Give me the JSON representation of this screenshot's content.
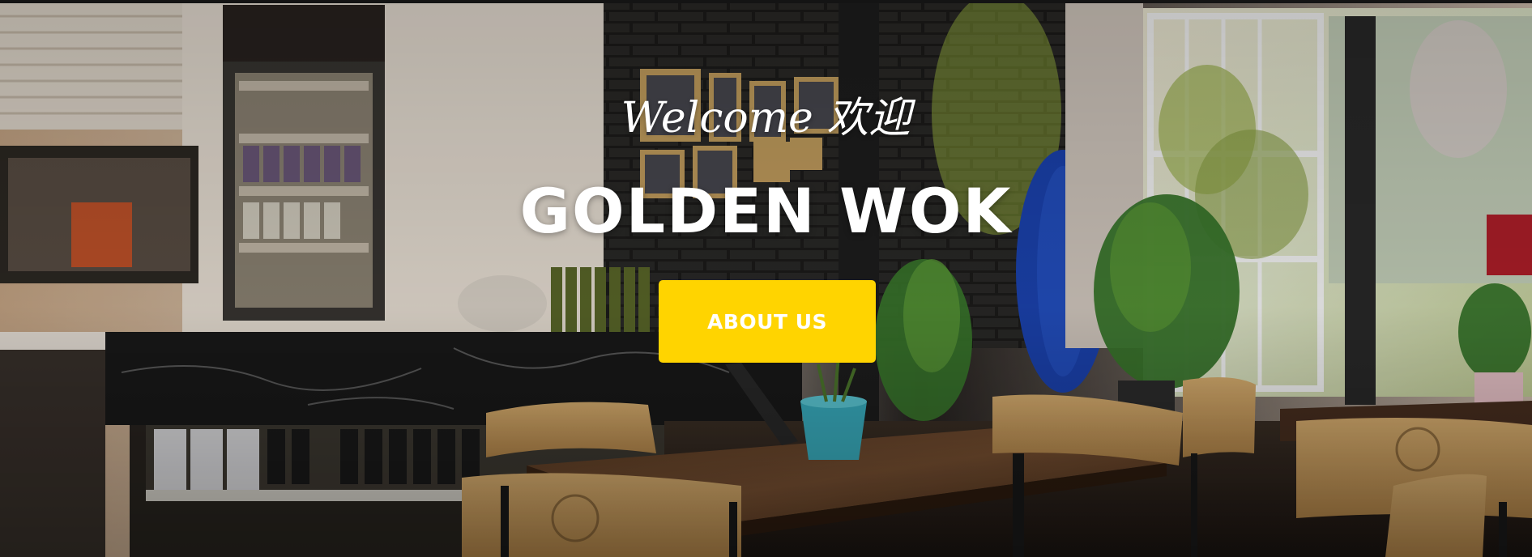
{
  "hero": {
    "welcome": "Welcome 欢迎",
    "title": "GOLDEN WOK",
    "cta_label": "ABOUT US"
  },
  "colors": {
    "cta_background": "#ffd400",
    "text": "#ffffff"
  },
  "background": {
    "scene": "cafe-interior-photo"
  }
}
